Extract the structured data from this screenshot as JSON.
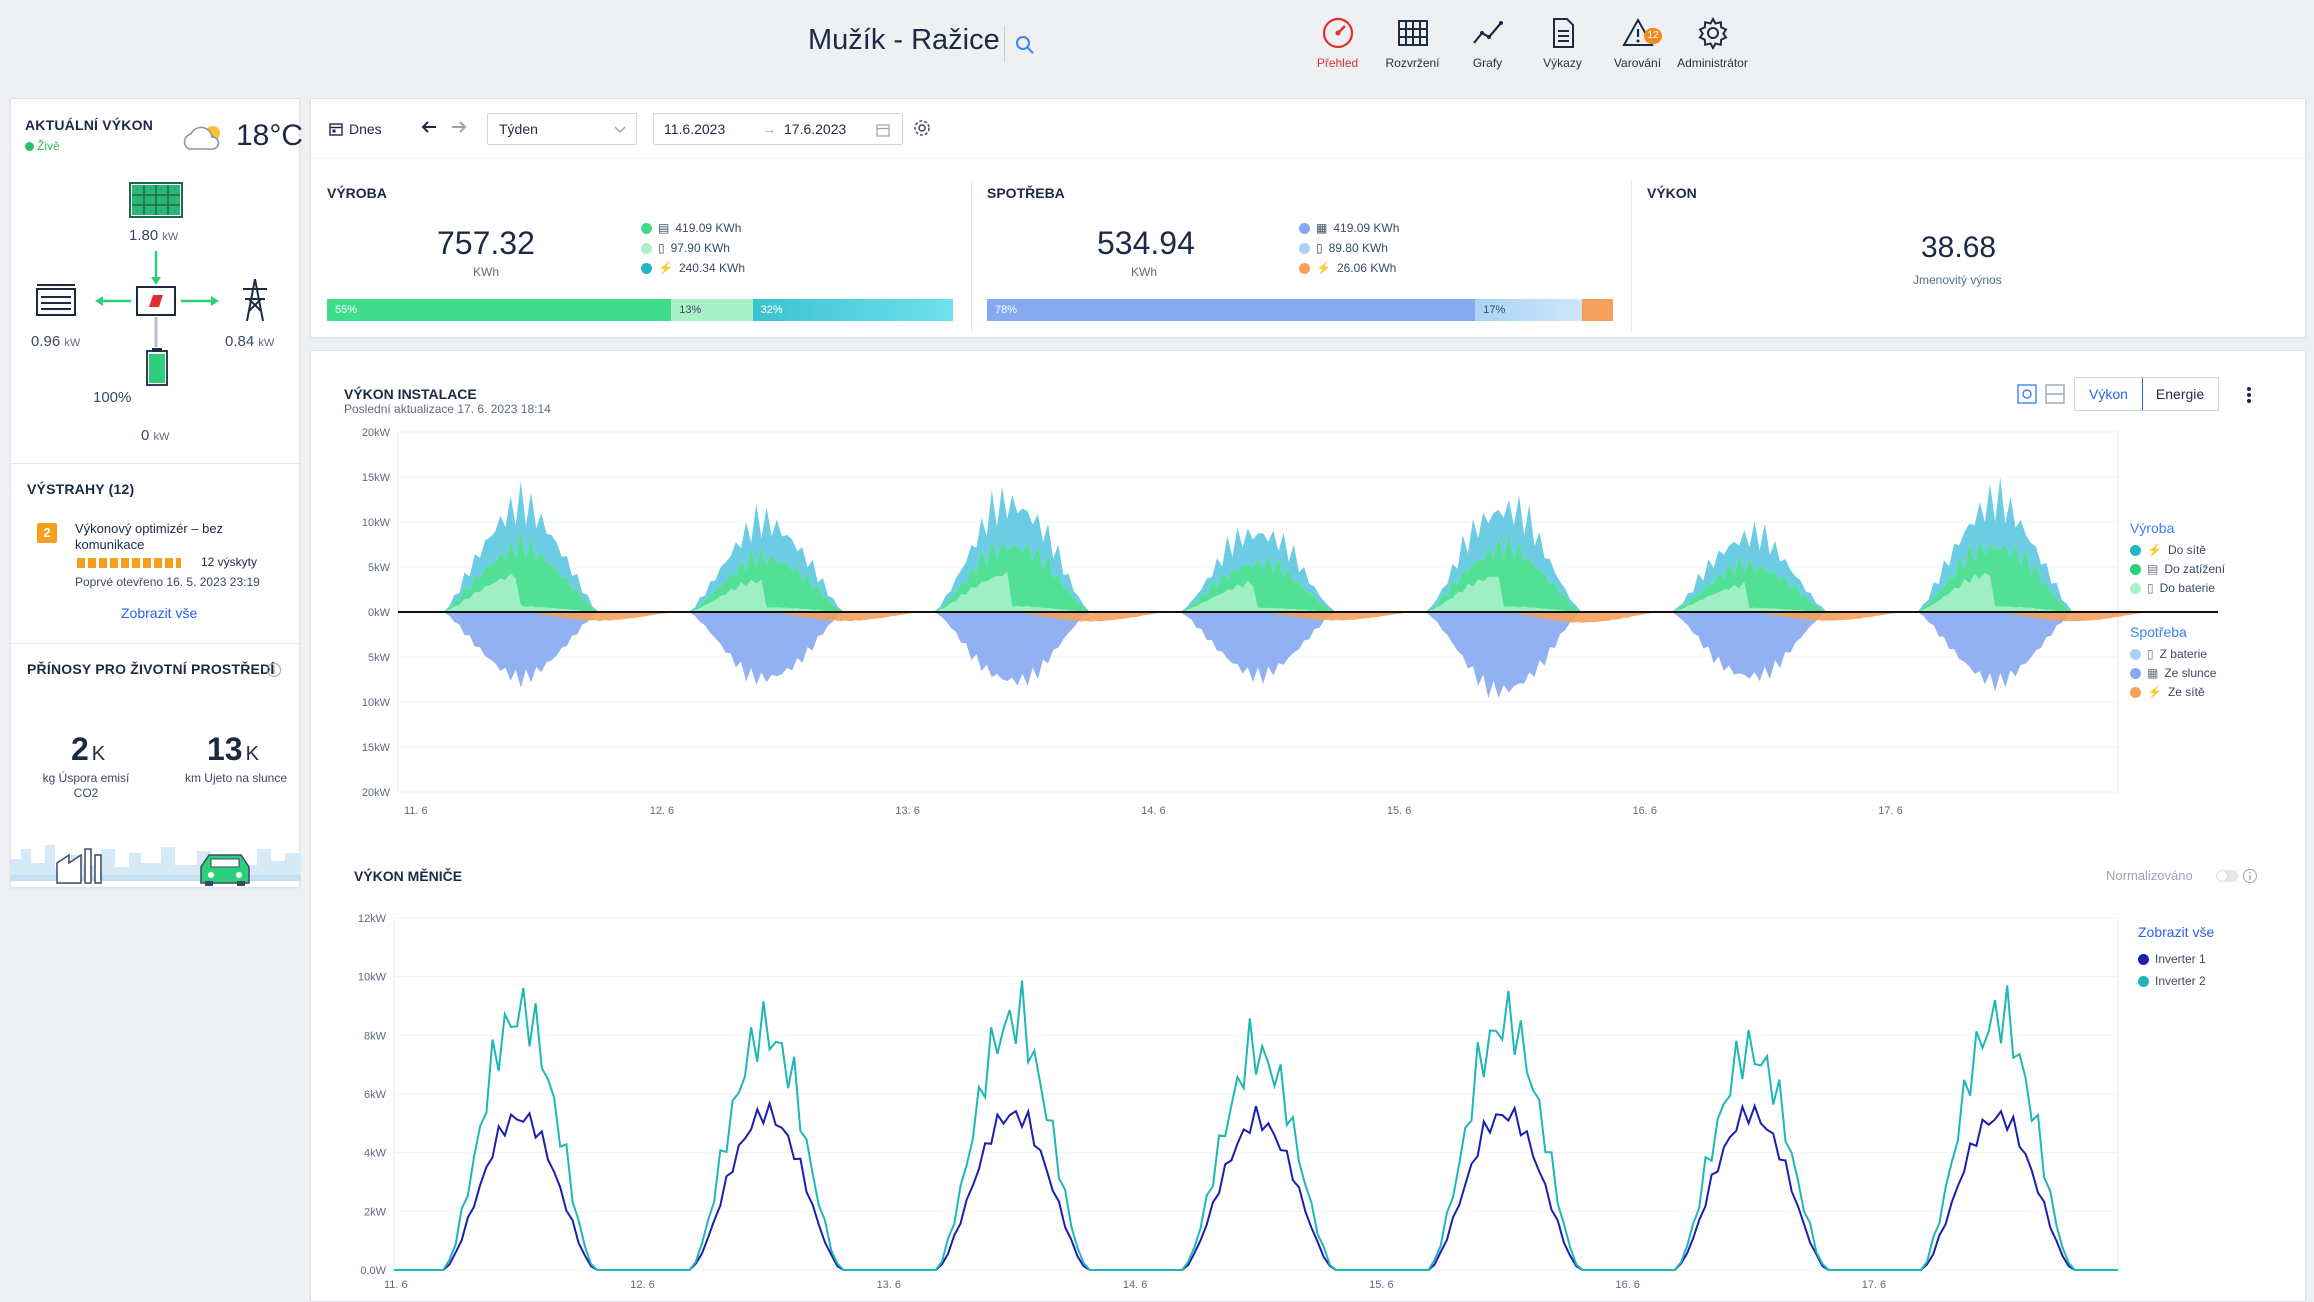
{
  "header": {
    "title": "Mužík - Ražice",
    "nav": [
      {
        "label": "Přehled",
        "icon": "gauge-icon",
        "active": true
      },
      {
        "label": "Rozvržení",
        "icon": "grid-icon"
      },
      {
        "label": "Grafy",
        "icon": "line-chart-icon"
      },
      {
        "label": "Výkazy",
        "icon": "document-icon"
      },
      {
        "label": "Varování",
        "icon": "warning-icon",
        "badge": "12"
      },
      {
        "label": "Administrátor",
        "icon": "gear-icon"
      }
    ]
  },
  "power_panel": {
    "title": "AKTUÁLNÍ VÝKON",
    "live": "Živě",
    "temperature": "18°C",
    "solar": {
      "value": "1.80",
      "unit": "kW"
    },
    "load": {
      "value": "0.96",
      "unit": "kW"
    },
    "grid": {
      "value": "0.84",
      "unit": "kW"
    },
    "battery": {
      "percent": "100%",
      "value": "0",
      "unit": "kW"
    }
  },
  "alerts": {
    "title": "VÝSTRAHY (12)",
    "item_num": "2",
    "item_title": "Výkonový optimizér – bez komunikace",
    "occurrences": "12 výskyty",
    "opened": "Poprvé otevřeno 16. 5. 2023 23:19",
    "show_all": "Zobrazit vše"
  },
  "environment": {
    "title": "PŘÍNOSY PRO ŽIVOTNÍ PROSTŘEDÍ",
    "co2": {
      "value": "2",
      "suffix": "K",
      "label": "kg Úspora emisí CO2"
    },
    "km": {
      "value": "13",
      "suffix": "K",
      "label": "km Ujeto na slunce"
    }
  },
  "toolbar": {
    "today": "Dnes",
    "period": "Týden",
    "date_from": "11.6.2023",
    "date_to": "17.6.2023"
  },
  "stats": {
    "production": {
      "title": "VÝROBA",
      "value": "757.32",
      "unit": "KWh",
      "rows": [
        "419.09 KWh",
        "97.90 KWh",
        "240.34 KWh"
      ],
      "bars": [
        {
          "label": "55%",
          "pct": 55
        },
        {
          "label": "13%",
          "pct": 13
        },
        {
          "label": "32%",
          "pct": 32
        }
      ]
    },
    "consumption": {
      "title": "SPOTŘEBA",
      "value": "534.94",
      "unit": "KWh",
      "rows": [
        "419.09 KWh",
        "89.80 KWh",
        "26.06 KWh"
      ],
      "bars": [
        {
          "label": "78%",
          "pct": 78
        },
        {
          "label": "17%",
          "pct": 17
        },
        {
          "label": "",
          "pct": 5
        }
      ]
    },
    "power": {
      "title": "VÝKON",
      "value": "38.68",
      "label": "Jmenovitý výnos"
    }
  },
  "chart1": {
    "title": "VÝKON INSTALACE",
    "subtitle": "Poslední aktualizace 17. 6. 2023 18:14",
    "toggle_power": "Výkon",
    "toggle_energy": "Energie",
    "legend_prod_title": "Výroba",
    "legend_prod": [
      "Do sítě",
      "Do zatížení",
      "Do baterie"
    ],
    "legend_cons_title": "Spotřeba",
    "legend_cons": [
      "Z baterie",
      "Ze slunce",
      "Ze sítě"
    ],
    "colors": {
      "grid": "#5bc6e0",
      "load": "#3fdd8b",
      "battery": "#a8f1c9",
      "from_batt": "#a9d3f5",
      "from_sun": "#86a9f2",
      "from_grid": "#f5a05c"
    }
  },
  "chart2": {
    "title": "VÝKON MĚNIČE",
    "normalized": "Normalizováno",
    "show_all": "Zobrazit vše",
    "series_names": [
      "Inverter 1",
      "Inverter 2"
    ],
    "colors": [
      "#1b1fb0",
      "#1eb7b8"
    ]
  },
  "chart_data": [
    {
      "type": "area",
      "x_ticks": [
        "11. 6",
        "12. 6",
        "13. 6",
        "14. 6",
        "15. 6",
        "16. 6",
        "17. 6"
      ],
      "y_ticks": [
        "20kW",
        "15kW",
        "10kW",
        "5kW",
        "0kW",
        "5kW",
        "10kW",
        "15kW",
        "20kW"
      ],
      "ylim": [
        -20,
        20
      ],
      "production_peaks_kw": [
        14.8,
        12.6,
        15.5,
        11.4,
        14.8,
        10.8,
        15.4
      ],
      "consumption_peaks_kw": [
        -8.5,
        -8.8,
        -9.2,
        -8.2,
        -10.4,
        -8.6,
        -9.0
      ]
    },
    {
      "type": "line",
      "x_ticks": [
        "11. 6",
        "12. 6",
        "13. 6",
        "14. 6",
        "15. 6",
        "16. 6",
        "17. 6"
      ],
      "y_ticks": [
        "12kW",
        "10kW",
        "8kW",
        "6kW",
        "4kW",
        "2kW",
        "0.0W"
      ],
      "ylim": [
        0,
        12
      ],
      "series": [
        {
          "name": "Inverter 1",
          "daily_peak_kw": [
            5.8,
            5.9,
            5.9,
            5.6,
            5.9,
            5.9,
            5.8
          ]
        },
        {
          "name": "Inverter 2",
          "daily_peak_kw": [
            10.5,
            9.7,
            10.2,
            8.8,
            10.1,
            8.9,
            10.3
          ]
        }
      ]
    }
  ]
}
